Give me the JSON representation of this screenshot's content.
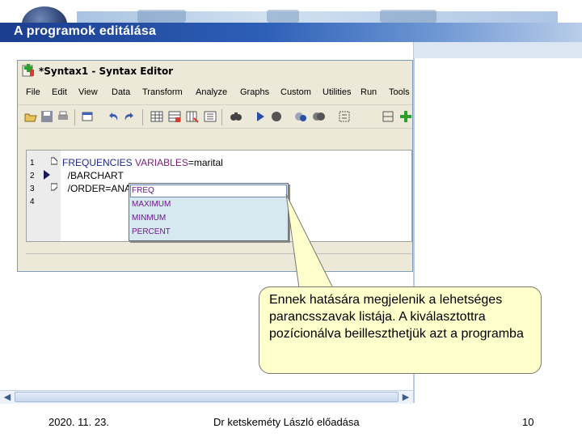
{
  "slide": {
    "title": "A programok  editálása",
    "date": "2020. 11. 23.",
    "author": "Dr ketskeméty László előadása",
    "page_number": "10"
  },
  "window": {
    "title": "*Syntax1 - Syntax Editor",
    "menu": [
      "File",
      "Edit",
      "View",
      "Data",
      "Transform",
      "Analyze",
      "Graphs",
      "Custom",
      "Utilities",
      "Run",
      "Tools"
    ],
    "toolbar_icons": [
      "open-icon",
      "save-icon",
      "print-icon",
      "undo-icon",
      "redo-icon",
      "dialog-recall-icon",
      "goto-data-icon",
      "goto-case-icon",
      "variables-icon",
      "find-icon",
      "run-icon",
      "stop-icon",
      "split-icon",
      "toggle-icon",
      "syntax-help-icon",
      "add-icon"
    ]
  },
  "editor": {
    "line_numbers": [
      "1",
      "2",
      "3",
      "4"
    ],
    "lines": [
      {
        "kw": "FREQUENCIES",
        "sub": " VARIABLES",
        "rest": "=marital"
      },
      {
        "kw": "",
        "sub": "",
        "rest": "  /BARCHART"
      },
      {
        "kw": "",
        "sub": "",
        "rest": "  /ORDER=ANA"
      }
    ]
  },
  "autocomplete": {
    "items": [
      "FREQ",
      "MAXIMUM",
      "MINMUM",
      "PERCENT"
    ]
  },
  "callout": {
    "text": "Ennek hatására megjelenik a lehetséges parancsszavak listája. A kiválasztottra pozícionálva beilleszthetjük azt a programba"
  },
  "colors": {
    "title_band": "#1b3d8f",
    "callout_bg": "#ffffcc",
    "autocomplete_bg": "#d6e8f0",
    "keyword": "#1f2a8a",
    "subcommand": "#7b1d7b"
  }
}
